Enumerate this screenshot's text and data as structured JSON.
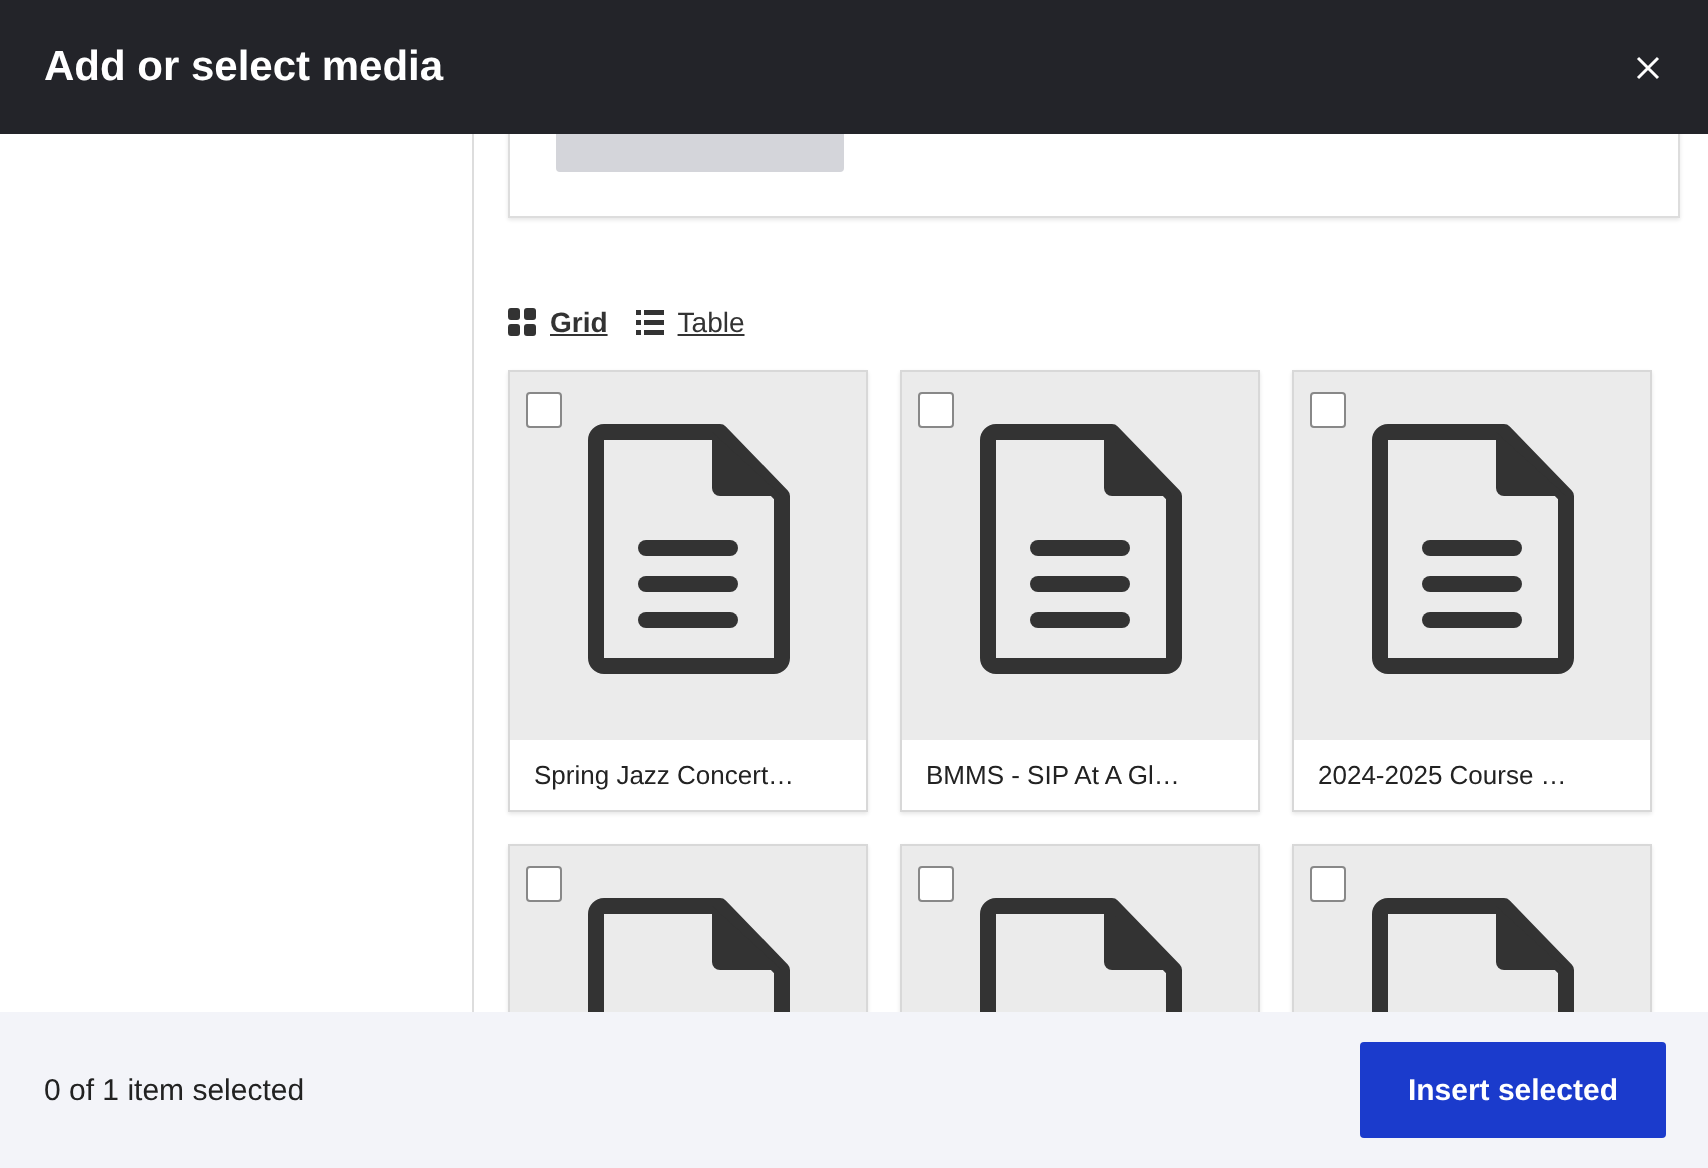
{
  "dialog": {
    "title": "Add or select media"
  },
  "view_toggle": [
    {
      "label": "Grid",
      "selected": true,
      "kind": "grid"
    },
    {
      "label": "Table",
      "selected": false,
      "kind": "table"
    }
  ],
  "media_items": [
    {
      "title": "Spring Jazz Concert…",
      "selected": false
    },
    {
      "title": "BMMS - SIP At A Gl…",
      "selected": false
    },
    {
      "title": "2024-2025 Course …",
      "selected": false
    },
    {
      "selected": false
    },
    {
      "selected": false
    },
    {
      "selected": false
    }
  ],
  "footer": {
    "status": "0 of 1 item selected",
    "button": "Insert selected"
  }
}
